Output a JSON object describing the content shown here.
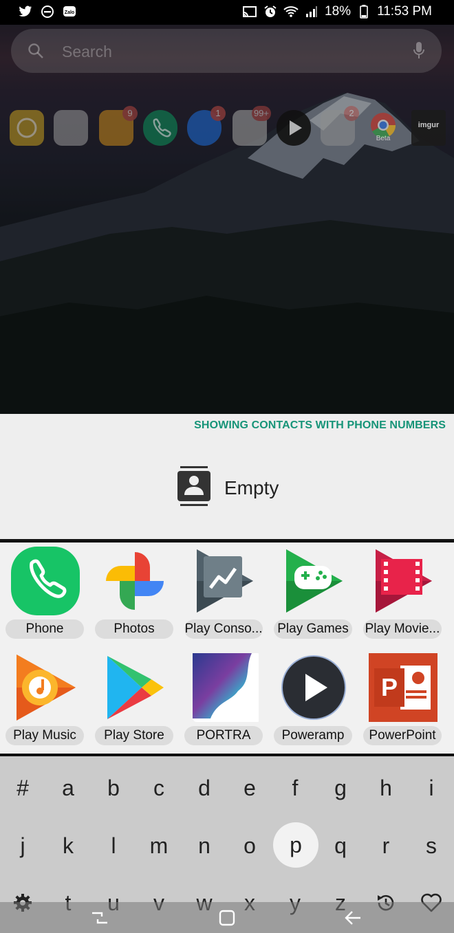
{
  "status_bar": {
    "battery": "18%",
    "time": "11:53 PM",
    "left_icons": [
      "twitter-icon",
      "do-not-disturb-icon",
      "zalo-icon"
    ],
    "right_icons": [
      "cast-icon",
      "alarm-icon",
      "wifi-icon",
      "signal-icon",
      "battery-icon"
    ]
  },
  "search": {
    "placeholder": "Search"
  },
  "dock": {
    "apps": [
      {
        "name": "bixby-app",
        "badge": "",
        "color": "#e5c02b"
      },
      {
        "name": "folder-app",
        "badge": "",
        "color": "#dcdcdc"
      },
      {
        "name": "messages-app",
        "badge": "9",
        "color": "#f4b43a"
      },
      {
        "name": "phone-app",
        "badge": "",
        "color": "#17b574"
      },
      {
        "name": "messenger-app",
        "badge": "1",
        "color": "#2b7cf0"
      },
      {
        "name": "google-folder-app",
        "badge": "99+",
        "color": "#e8e8e8"
      },
      {
        "name": "poweramp-app",
        "badge": "",
        "color": "#1f1f1f"
      },
      {
        "name": "social-folder-app",
        "badge": "2",
        "color": "#d8d8d8"
      },
      {
        "name": "chrome-beta-app",
        "badge": "",
        "color": "#ffffff",
        "caption": "Beta"
      },
      {
        "name": "imgur-app",
        "badge": "",
        "color": "#2b2b2b",
        "caption": "imgur"
      }
    ]
  },
  "contacts": {
    "header": "SHOWING CONTACTS WITH PHONE NUMBERS",
    "empty_text": "Empty",
    "accent": "#169478"
  },
  "apps": {
    "items": [
      {
        "label": "Phone",
        "icon": "phone-icon"
      },
      {
        "label": "Photos",
        "icon": "photos-icon"
      },
      {
        "label": "Play Conso...",
        "icon": "play-console-icon"
      },
      {
        "label": "Play Games",
        "icon": "play-games-icon"
      },
      {
        "label": "Play Movie...",
        "icon": "play-movies-icon"
      },
      {
        "label": "Play Music",
        "icon": "play-music-icon"
      },
      {
        "label": "Play Store",
        "icon": "play-store-icon"
      },
      {
        "label": "PORTRA",
        "icon": "portra-icon"
      },
      {
        "label": "Poweramp",
        "icon": "poweramp-icon"
      },
      {
        "label": "PowerPoint",
        "icon": "powerpoint-icon"
      }
    ]
  },
  "keyboard": {
    "row1": [
      "#",
      "a",
      "b",
      "c",
      "d",
      "e",
      "f",
      "g",
      "h",
      "i"
    ],
    "row2": [
      "j",
      "k",
      "l",
      "m",
      "n",
      "o",
      "p",
      "q",
      "r",
      "s"
    ],
    "row3": [
      "t",
      "u",
      "v",
      "w",
      "x",
      "y",
      "z"
    ],
    "active_key": "p",
    "left_icon": "gear-icon",
    "right_icons": [
      "history-icon",
      "heart-icon"
    ]
  },
  "nav": {
    "icons": [
      "recents-icon",
      "home-icon",
      "back-icon"
    ]
  }
}
